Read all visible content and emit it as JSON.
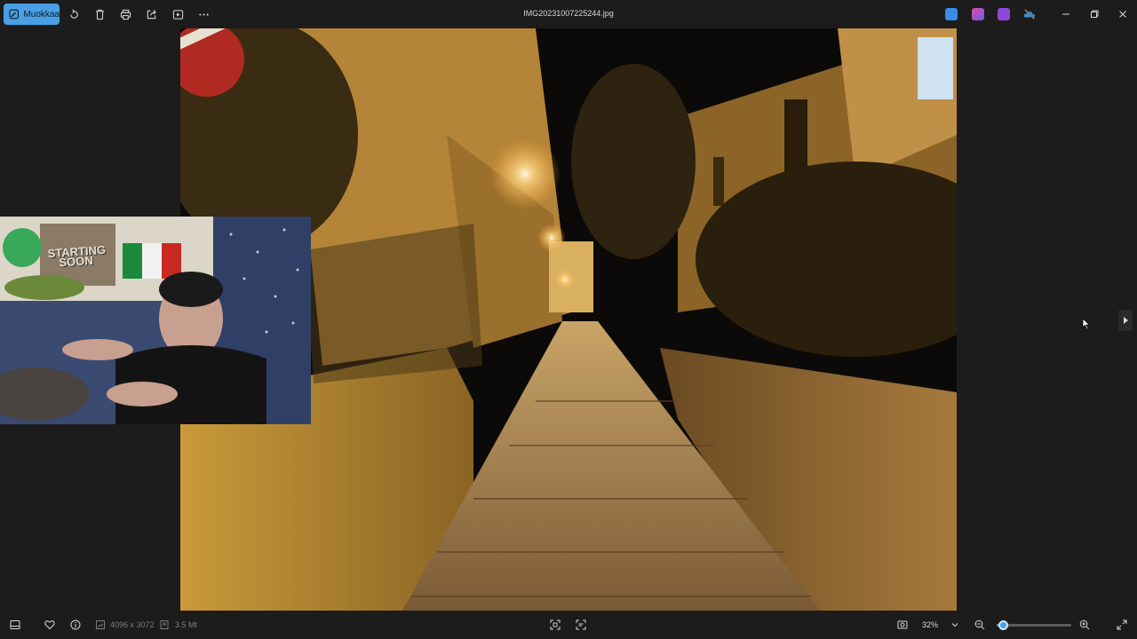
{
  "toolbar": {
    "edit_label": "Muokkaa",
    "icons": [
      "rotate-icon",
      "delete-icon",
      "print-icon",
      "share-icon",
      "slideshow-icon",
      "more-icon"
    ]
  },
  "window": {
    "title": "IMG20231007225244.jpg"
  },
  "apps": {
    "colors": [
      "#3b8be8",
      "#b04bd8",
      "#8e48d6",
      "#3a8fd6"
    ]
  },
  "webcam": {
    "banner_text_1": "STARTING",
    "banner_text_2": "SOON"
  },
  "bottom": {
    "dimensions": "4096 x 3072",
    "file_size": "3.5 Mt",
    "zoom": "32%",
    "zoom_level": 0.08
  },
  "colors": {
    "accent": "#4aa0e6",
    "background": "#1c1c1c"
  }
}
